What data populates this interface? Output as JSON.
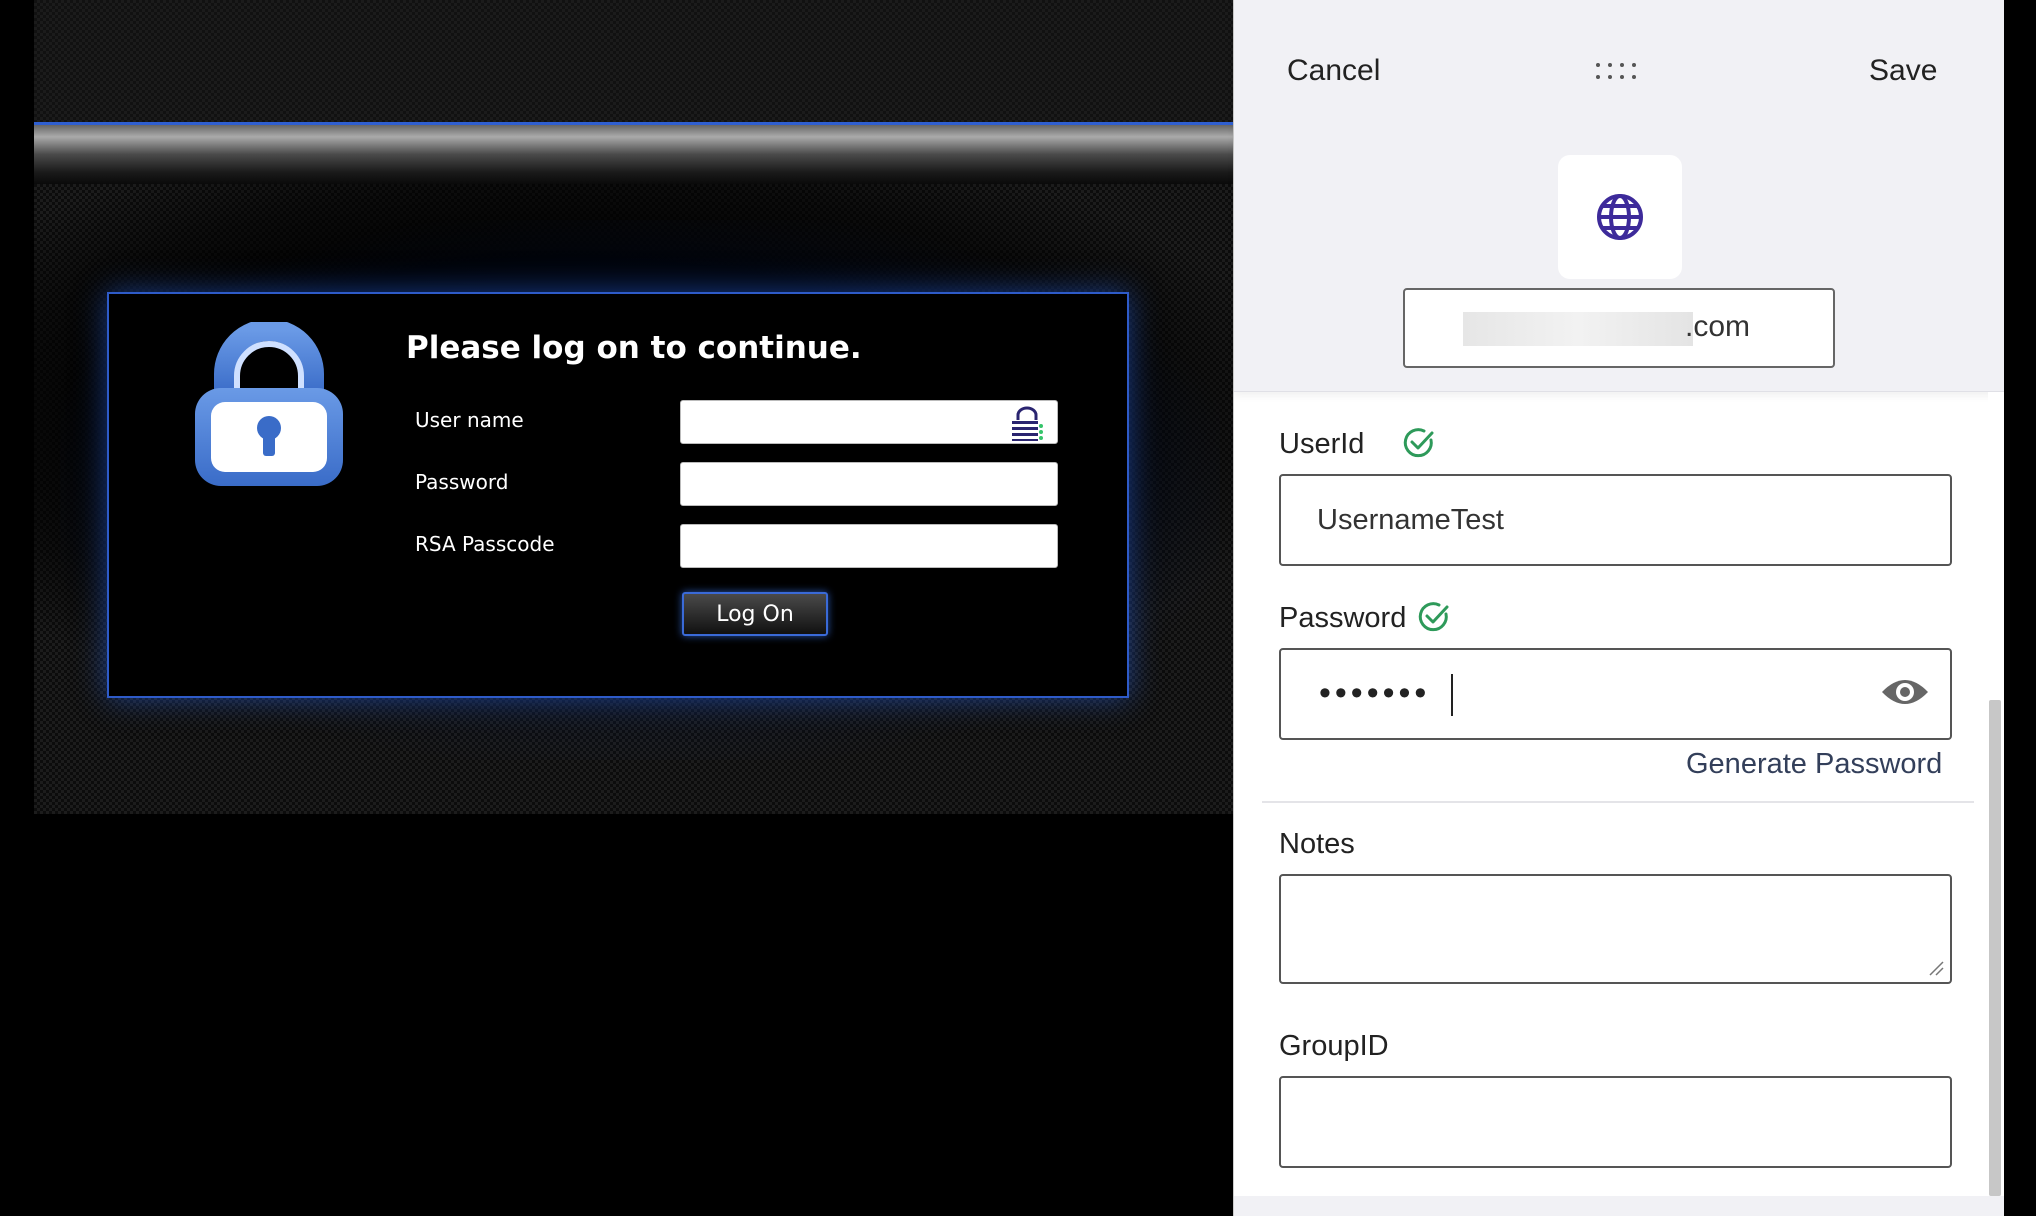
{
  "webpage": {
    "login": {
      "title": "Please log on to continue.",
      "fields": [
        {
          "label": "User name",
          "value": ""
        },
        {
          "label": "Password",
          "value": ""
        },
        {
          "label": "RSA Passcode",
          "value": ""
        }
      ],
      "logon_button": "Log On"
    }
  },
  "panel": {
    "cancel_label": "Cancel",
    "save_label": "Save",
    "site": {
      "icon": "globe-icon",
      "url_visible": ".com"
    },
    "userid": {
      "label": "UserId",
      "value": "UsernameTest",
      "status_icon": "check-circle-icon"
    },
    "password": {
      "label": "Password",
      "masked_value": "•••••••",
      "status_icon": "check-circle-icon",
      "toggle_icon": "eye-icon"
    },
    "generate_password_label": "Generate Password",
    "notes": {
      "label": "Notes",
      "value": ""
    },
    "groupid": {
      "label": "GroupID",
      "value": ""
    }
  },
  "colors": {
    "accent_blue": "#2e5bc9",
    "check_green": "#2e9a5a",
    "globe_purple": "#3d2a9a",
    "lock_blue": "#4a7fd6"
  }
}
